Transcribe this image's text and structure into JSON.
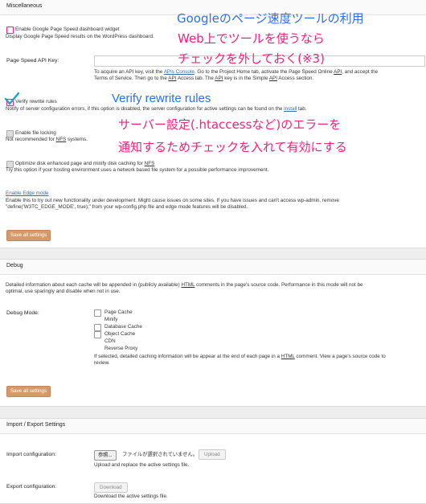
{
  "misc": {
    "section_title": "Miscellaneous",
    "pagespeed_widget_label": "Enable Google Page Speed dashboard widget",
    "pagespeed_widget_desc": "Display Google Page Speed results on the WordPress dashboard.",
    "api_key_label": "Page Speed API Key:",
    "api_key_help_1": "To acquire an API key, visit the ",
    "api_key_help_link1": "APIs Console",
    "api_key_help_2": ". Go to the Project Home tab, activate the Page Speed Online ",
    "api_key_help_link2": "API",
    "api_key_help_3": ", and accept the",
    "api_key_help_4": "Terms of Service. Then go to the ",
    "api_key_help_link3": "API",
    "api_key_help_5": " Access tab. The ",
    "api_key_help_link4": "API",
    "api_key_help_6": " key is in the Simple ",
    "api_key_help_link5": "API",
    "api_key_help_7": " Access section.",
    "verify_label": "Verify rewrite rules",
    "verify_desc_1": "Notify of server configuration errors, if this option is disabled, the server configuration for active settings can be found on the ",
    "verify_desc_link": "install",
    "verify_desc_2": " tab.",
    "file_locking_label": "Enable file locking",
    "file_locking_desc_1": "Not recommended for ",
    "file_locking_desc_abbr": "NFS",
    "file_locking_desc_2": " systems.",
    "nfs_label_1": "Optimize disk enhanced page and minify disk caching for ",
    "nfs_label_abbr": "NFS",
    "nfs_desc": "Try this option if your hosting environment uses a network based file system for a possible performance improvement.",
    "edge_link": "Enable Edge mode",
    "edge_desc_1": "Enable this to try out new functionality under development. Might cause issues on some sites. If you have issues and can't access wp-admin, remove",
    "edge_desc_2": "\"define('W3TC_EDGE_MODE', true);\" from your wp-config.php file and edge mode features will be disabled.",
    "save_label": "Save all settings"
  },
  "annotations": {
    "line1": "Googleのページ速度ツールの利用",
    "line2": "Web上でツールを使うなら",
    "line3": "チェックを外しておく(※3)",
    "verify_en": "Verify rewrite rules",
    "line4": "サーバー設定(.htaccessなど)のエラーを",
    "line5": "通知するためチェックを入れて有効にする",
    "blue_color": "#2d6fe8",
    "pink_color": "#f0227e"
  },
  "debug": {
    "section_title": "Debug",
    "desc_1": "Detailed information about each cache will be appended in (publicly available) ",
    "desc_abbr": "HTML",
    "desc_2": " comments in the page's source code. Performance in this mode will not be",
    "desc_3": "optimal, use sparingly and disable when not in use.",
    "mode_label": "Debug Mode:",
    "options": [
      "Page Cache",
      "Minify",
      "Database Cache",
      "Object Cache",
      "CDN",
      "Reverse Proxy"
    ],
    "help_1": "If selected, detailed caching information will be appear at the end of each page in a ",
    "help_abbr": "HTML",
    "help_2": " comment. View a page's source code to",
    "help_3": "review.",
    "save_label": "Save all settings"
  },
  "import_export": {
    "section_title": "Import / Export Settings",
    "import_label": "Import configuration:",
    "browse_label": "参照...",
    "no_file_text": "ファイルが選択されていません。",
    "upload_label": "Upload",
    "import_desc": "Upload and replace the active settings file.",
    "export_label": "Export configuration:",
    "download_label": "Download",
    "export_desc": "Download the active settings file."
  }
}
